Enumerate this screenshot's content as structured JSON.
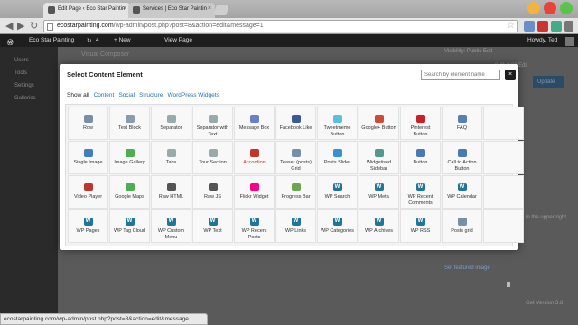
{
  "browser": {
    "tabs": [
      {
        "title": "Edit Page ‹ Eco Star Paintin",
        "active": true
      },
      {
        "title": "Services | Eco Star Paintin",
        "active": false
      }
    ],
    "url_domain": "ecostarpainting.com",
    "url_path": "/wp-admin/post.php?post=8&action=edit&message=1",
    "status_text": "ecostarpainting.com/wp-admin/post.php?post=8&action=edit&message..."
  },
  "adminbar": {
    "site_name": "Eco Star Painting",
    "updates": "4",
    "new_label": "+ New",
    "view_page": "View Page",
    "greeting": "Howdy, Ted"
  },
  "background": {
    "sidebar_items": [
      "Users",
      "Tools",
      "Settings",
      "Galleries"
    ],
    "visual_composer": "Visual Composer",
    "visibility": "Visibility: Public Edit",
    "update_label": "Update",
    "upper_right": "in the upper right",
    "set_featured": "Set featured image",
    "version": "Get Version 3.8",
    "publish_date": "8 @ 2:31 Edit"
  },
  "modal": {
    "title": "Select Content Element",
    "search_placeholder": "Search by element name",
    "close": "×",
    "filters": [
      "Show all",
      "Content",
      "Social",
      "Structure",
      "WordPress Widgets"
    ],
    "elements": [
      {
        "label": "Row",
        "icon": "row-icon",
        "color": "#7a8fa6"
      },
      {
        "label": "Text Block",
        "icon": "text-block-icon",
        "color": "#8a9bb0"
      },
      {
        "label": "Separator",
        "icon": "separator-icon",
        "color": "#9aa"
      },
      {
        "label": "Separator with Text",
        "icon": "separator-text-icon",
        "color": "#9aa"
      },
      {
        "label": "Message Box",
        "icon": "message-box-icon",
        "color": "#6b7fc9"
      },
      {
        "label": "Facebook Like",
        "icon": "facebook-icon",
        "color": "#3b5998"
      },
      {
        "label": "Tweetmeme Button",
        "icon": "tweetmeme-icon",
        "color": "#5bc0de"
      },
      {
        "label": "Google+ Button",
        "icon": "google-plus-icon",
        "color": "#d34836"
      },
      {
        "label": "Pinterest Button",
        "icon": "pinterest-icon",
        "color": "#cb2027"
      },
      {
        "label": "FAQ",
        "icon": "faq-icon",
        "color": "#5a7fb5"
      },
      {
        "label": "",
        "icon": "empty-icon",
        "color": "transparent"
      },
      {
        "label": "Single Image",
        "icon": "single-image-icon",
        "color": "#3f7fbf"
      },
      {
        "label": "Image Gallery",
        "icon": "image-gallery-icon",
        "color": "#4caf50"
      },
      {
        "label": "Tabs",
        "icon": "tabs-icon",
        "color": "#9aa"
      },
      {
        "label": "Tour Section",
        "icon": "tour-section-icon",
        "color": "#9aa"
      },
      {
        "label": "Accordion",
        "icon": "accordion-icon",
        "color": "#c2352c"
      },
      {
        "label": "Teaser (posts) Grid",
        "icon": "teaser-grid-icon",
        "color": "#7a8fa6"
      },
      {
        "label": "Posts Slider",
        "icon": "posts-slider-icon",
        "color": "#3b8fd6"
      },
      {
        "label": "Widgetised Sidebar",
        "icon": "widget-sidebar-icon",
        "color": "#4f9a8a"
      },
      {
        "label": "Button",
        "icon": "button-icon",
        "color": "#4a7ab5"
      },
      {
        "label": "Call to Action Button",
        "icon": "cta-icon",
        "color": "#4a7ab5"
      },
      {
        "label": "",
        "icon": "empty-icon",
        "color": "transparent"
      },
      {
        "label": "Video Player",
        "icon": "video-player-icon",
        "color": "#c2352c"
      },
      {
        "label": "Google Maps",
        "icon": "google-maps-icon",
        "color": "#4caf50"
      },
      {
        "label": "Raw HTML",
        "icon": "raw-html-icon",
        "color": "#555"
      },
      {
        "label": "Raw JS",
        "icon": "raw-js-icon",
        "color": "#555"
      },
      {
        "label": "Flickr Widget",
        "icon": "flickr-icon",
        "color": "#ff0084"
      },
      {
        "label": "Progress Bar",
        "icon": "progress-bar-icon",
        "color": "#6aa84f"
      },
      {
        "label": "WP Search",
        "icon": "wp-icon",
        "color": "#21759b"
      },
      {
        "label": "WP Meta",
        "icon": "wp-icon",
        "color": "#21759b"
      },
      {
        "label": "WP Recent Comments",
        "icon": "wp-icon",
        "color": "#21759b"
      },
      {
        "label": "WP Calendar",
        "icon": "wp-icon",
        "color": "#21759b"
      },
      {
        "label": "",
        "icon": "empty-icon",
        "color": "transparent"
      },
      {
        "label": "WP Pages",
        "icon": "wp-icon",
        "color": "#21759b"
      },
      {
        "label": "WP Tag Cloud",
        "icon": "wp-icon",
        "color": "#21759b"
      },
      {
        "label": "WP Custom Menu",
        "icon": "wp-icon",
        "color": "#21759b"
      },
      {
        "label": "WP Text",
        "icon": "wp-icon",
        "color": "#21759b"
      },
      {
        "label": "WP Recent Posts",
        "icon": "wp-icon",
        "color": "#21759b"
      },
      {
        "label": "WP Links",
        "icon": "wp-icon",
        "color": "#21759b"
      },
      {
        "label": "WP Categories",
        "icon": "wp-icon",
        "color": "#21759b"
      },
      {
        "label": "WP Archives",
        "icon": "wp-icon",
        "color": "#21759b"
      },
      {
        "label": "WP RSS",
        "icon": "wp-icon",
        "color": "#21759b"
      },
      {
        "label": "Posts grid",
        "icon": "posts-grid-icon",
        "color": "#7a8fa6"
      },
      {
        "label": "",
        "icon": "empty-icon",
        "color": "transparent"
      }
    ]
  }
}
